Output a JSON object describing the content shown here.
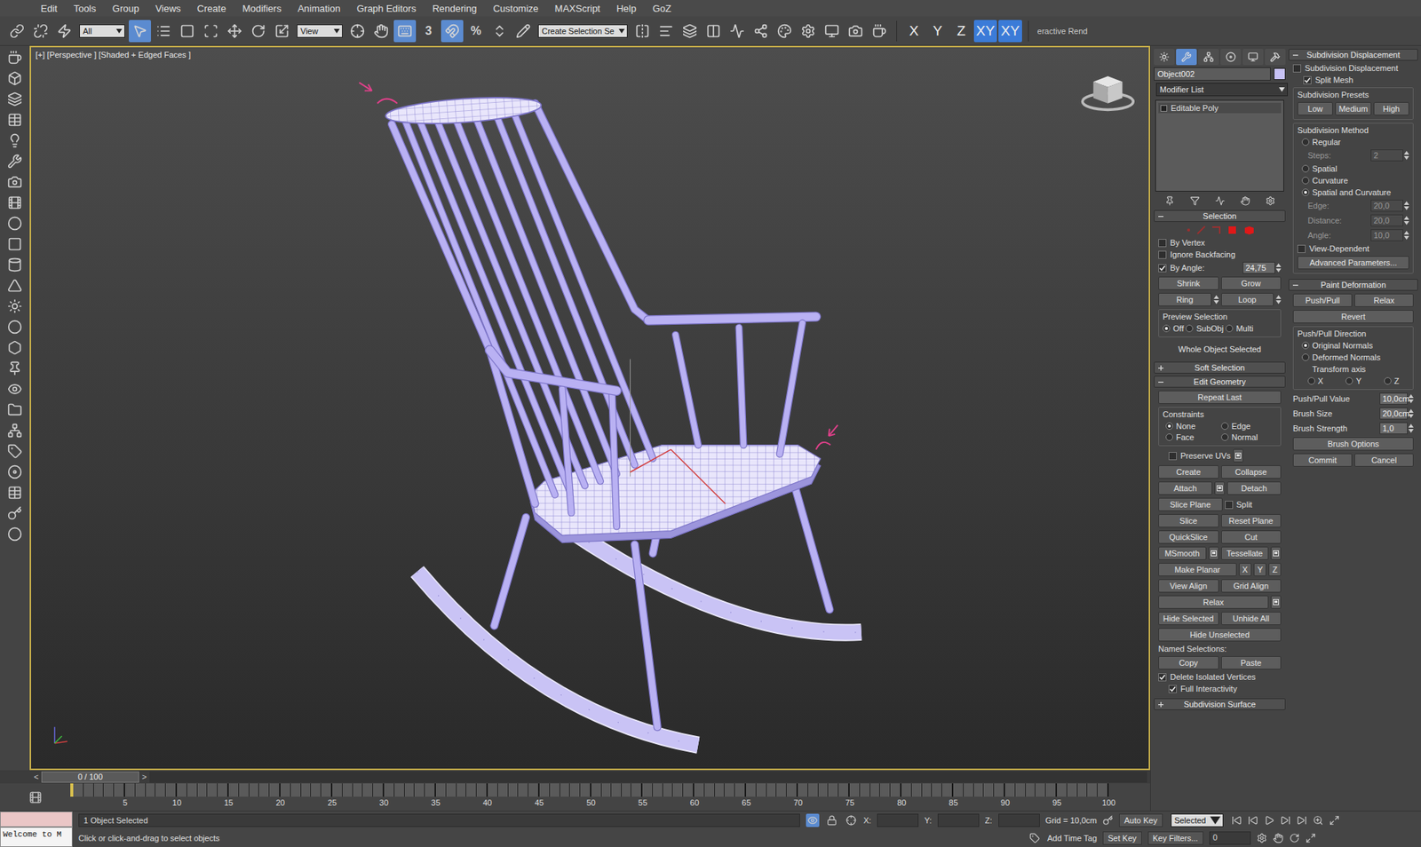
{
  "menu": [
    "Edit",
    "Tools",
    "Group",
    "Views",
    "Create",
    "Modifiers",
    "Animation",
    "Graph Editors",
    "Rendering",
    "Customize",
    "MAXScript",
    "Help",
    "GoZ"
  ],
  "toolbar": {
    "items": [
      {
        "kind": "icon",
        "icon": "link",
        "selected": false
      },
      {
        "kind": "icon",
        "icon": "unlink",
        "selected": false
      },
      {
        "kind": "icon",
        "icon": "bind",
        "selected": false
      },
      {
        "kind": "dropdown",
        "label": "All"
      },
      {
        "kind": "icon",
        "icon": "select",
        "selected": true
      },
      {
        "kind": "icon",
        "icon": "select-name",
        "selected": false
      },
      {
        "kind": "icon",
        "icon": "region",
        "selected": false
      },
      {
        "kind": "icon",
        "icon": "window",
        "selected": false
      },
      {
        "kind": "icon",
        "icon": "move",
        "selected": false
      },
      {
        "kind": "icon",
        "icon": "rotate",
        "selected": false
      },
      {
        "kind": "icon",
        "icon": "scale",
        "selected": false
      },
      {
        "kind": "dropdown",
        "label": "View"
      },
      {
        "kind": "icon",
        "icon": "pivot",
        "selected": false
      },
      {
        "kind": "icon",
        "icon": "manipulate",
        "selected": false
      },
      {
        "kind": "icon",
        "icon": "keyboard",
        "selected": true
      },
      {
        "kind": "snap",
        "label": "3",
        "selected": false
      },
      {
        "kind": "icon",
        "icon": "angle-snap",
        "selected": true
      },
      {
        "kind": "snap",
        "label": "%",
        "selected": false
      },
      {
        "kind": "icon",
        "icon": "spinner-snap",
        "selected": false
      },
      {
        "kind": "icon",
        "icon": "edit-named",
        "selected": false
      },
      {
        "kind": "dropdown",
        "label": "Create Selection Se"
      },
      {
        "kind": "icon",
        "icon": "mirror",
        "selected": false
      },
      {
        "kind": "icon",
        "icon": "align",
        "selected": false
      },
      {
        "kind": "icon",
        "icon": "layers",
        "selected": false
      },
      {
        "kind": "icon",
        "icon": "ribbon",
        "selected": false
      },
      {
        "kind": "icon",
        "icon": "curve",
        "selected": false
      },
      {
        "kind": "icon",
        "icon": "schematic",
        "selected": false
      },
      {
        "kind": "icon",
        "icon": "material",
        "selected": false
      },
      {
        "kind": "icon",
        "icon": "render-setup",
        "selected": false
      },
      {
        "kind": "icon",
        "icon": "rendered-frame",
        "selected": false
      },
      {
        "kind": "icon",
        "icon": "render",
        "selected": false
      },
      {
        "kind": "icon",
        "icon": "teapot",
        "selected": false
      },
      {
        "kind": "sep"
      },
      {
        "kind": "axis",
        "label": "X",
        "selected": false
      },
      {
        "kind": "axis",
        "label": "Y",
        "selected": false
      },
      {
        "kind": "axis",
        "label": "Z",
        "selected": false
      },
      {
        "kind": "axis",
        "label": "XY",
        "selected": true
      },
      {
        "kind": "axis",
        "label": "XY",
        "selected": true
      },
      {
        "kind": "sep"
      },
      {
        "kind": "text",
        "label": "eractive Rend"
      }
    ]
  },
  "viewport": {
    "label": "[+] [Perspective ] [Shaded + Edged Faces ]"
  },
  "command_panel": {
    "tabs": [
      {
        "kind": "create",
        "selected": false
      },
      {
        "kind": "modify",
        "selected": true
      },
      {
        "kind": "hierarchy",
        "selected": false
      },
      {
        "kind": "motion",
        "selected": false
      },
      {
        "kind": "display",
        "selected": false
      },
      {
        "kind": "utilities",
        "selected": false
      }
    ],
    "object_name": "Object002",
    "object_color": "#c8c2f6",
    "modifier_list": "Modifier List",
    "stack": [
      {
        "label": "Editable Poly",
        "selected": false
      }
    ],
    "selection": {
      "title": "Selection",
      "expanded": true,
      "checks": [
        {
          "label": "By Vertex",
          "checked": false
        },
        {
          "label": "Ignore Backfacing",
          "checked": false
        }
      ],
      "by_angle": {
        "label": "By Angle:",
        "checked": true,
        "value": "24,75"
      },
      "grow_buttons": [
        "Shrink",
        "Grow"
      ],
      "ring": "Ring",
      "loop": "Loop",
      "preview": {
        "title": "Preview Selection",
        "options": [
          {
            "label": "Off",
            "selected": true
          },
          {
            "label": "SubObj",
            "selected": false
          },
          {
            "label": "Multi",
            "selected": false
          }
        ]
      },
      "status": "Whole Object Selected"
    },
    "soft_selection": {
      "title": "Soft Selection",
      "expanded": false
    },
    "edit_geometry": {
      "title": "Edit Geometry",
      "expanded": true,
      "repeat_last": "Repeat Last",
      "constraints": {
        "title": "Constraints",
        "options": [
          {
            "label": "None",
            "selected": true
          },
          {
            "label": "Edge",
            "selected": false
          },
          {
            "label": "Face",
            "selected": false
          },
          {
            "label": "Normal",
            "selected": false
          }
        ]
      },
      "preserve_uvs": {
        "label": "Preserve UVs",
        "checked": false
      },
      "rows": [
        [
          {
            "kind": "button",
            "label": "Create"
          },
          {
            "kind": "button",
            "label": "Collapse"
          }
        ],
        [
          {
            "kind": "button-settings",
            "label": "Attach"
          },
          {
            "kind": "button",
            "label": "Detach"
          }
        ],
        [
          {
            "kind": "button",
            "label": "Slice Plane"
          },
          {
            "kind": "check",
            "label": "Split",
            "checked": false
          }
        ],
        [
          {
            "kind": "button",
            "label": "Slice"
          },
          {
            "kind": "button",
            "label": "Reset Plane"
          }
        ],
        [
          {
            "kind": "button",
            "label": "QuickSlice"
          },
          {
            "kind": "button",
            "label": "Cut"
          }
        ],
        [
          {
            "kind": "button-settings",
            "label": "MSmooth"
          },
          {
            "kind": "button-settings",
            "label": "Tessellate"
          }
        ],
        [
          {
            "kind": "button",
            "label": "Make Planar"
          },
          {
            "kind": "small",
            "label": "X"
          },
          {
            "kind": "small",
            "label": "Y"
          },
          {
            "kind": "small",
            "label": "Z"
          }
        ],
        [
          {
            "kind": "button",
            "label": "View Align"
          },
          {
            "kind": "button",
            "label": "Grid Align"
          }
        ],
        [
          {
            "kind": "button-settings",
            "label": "Relax"
          }
        ],
        [
          {
            "kind": "button",
            "label": "Hide Selected"
          },
          {
            "kind": "button",
            "label": "Unhide All"
          }
        ],
        [
          {
            "kind": "button",
            "label": "Hide Unselected"
          }
        ]
      ],
      "named_selections": {
        "label": "Named Selections:",
        "buttons": [
          "Copy",
          "Paste"
        ]
      },
      "checks": [
        {
          "label": "Delete Isolated Vertices",
          "checked": true
        },
        {
          "label": "Full Interactivity",
          "checked": true
        }
      ]
    },
    "subdivision_surface": {
      "title": "Subdivision Surface",
      "expanded": false
    },
    "subdivision_displacement": {
      "title": "Subdivision Displacement",
      "expanded": true,
      "checks": [
        {
          "label": "Subdivision Displacement",
          "checked": false
        },
        {
          "label": "Split Mesh",
          "checked": true
        }
      ],
      "presets": {
        "title": "Subdivision Presets",
        "buttons": [
          "Low",
          "Medium",
          "High"
        ]
      },
      "method": {
        "title": "Subdivision Method",
        "options": [
          {
            "label": "Regular",
            "selected": false
          },
          {
            "label": "Spatial",
            "selected": false
          },
          {
            "label": "Curvature",
            "selected": false
          },
          {
            "label": "Spatial and Curvature",
            "selected": true
          }
        ],
        "steps": {
          "label": "Steps:",
          "value": "2",
          "disabled": true
        },
        "fields": [
          {
            "label": "Edge:",
            "value": "20,0"
          },
          {
            "label": "Distance:",
            "value": "20,0"
          },
          {
            "label": "Angle:",
            "value": "10,0"
          }
        ]
      },
      "view_dependent": {
        "label": "View-Dependent",
        "checked": false
      },
      "advanced": "Advanced Parameters..."
    },
    "paint_deformation": {
      "title": "Paint Deformation",
      "expanded": true,
      "buttons": [
        "Push/Pull",
        "Relax"
      ],
      "revert": "Revert",
      "direction": {
        "title": "Push/Pull Direction",
        "options": [
          {
            "label": "Original Normals",
            "selected": true
          },
          {
            "label": "Deformed Normals",
            "selected": false
          }
        ],
        "axis_label": "Transform axis",
        "axes": [
          {
            "label": "X",
            "selected": false
          },
          {
            "label": "Y",
            "selected": false
          },
          {
            "label": "Z",
            "selected": false
          }
        ]
      },
      "fields": [
        {
          "label": "Push/Pull Value",
          "value": "10,0cm"
        },
        {
          "label": "Brush Size",
          "value": "20,0cm"
        },
        {
          "label": "Brush Strength",
          "value": "1,0"
        }
      ],
      "brush_options": "Brush Options",
      "actions": [
        "Commit",
        "Cancel"
      ]
    }
  },
  "timeline": {
    "prev": "<",
    "frame": "0 / 100",
    "next": ">",
    "ticks": [
      "5",
      "10",
      "15",
      "20",
      "25",
      "30",
      "35",
      "40",
      "45",
      "50",
      "55",
      "60",
      "65",
      "70",
      "75",
      "80",
      "85",
      "90",
      "95",
      "100"
    ]
  },
  "status": {
    "listener": "Welcome to M",
    "selection": "1 Object Selected",
    "prompt": "Click or click-and-drag to select objects",
    "coords": [
      "X:",
      "Y:",
      "Z:"
    ],
    "grid": "Grid = 10,0cm",
    "time_tag": "Add Time Tag",
    "auto_key": "Auto Key",
    "key_mode": "Selected",
    "set_key": "Set Key",
    "key_filters": "Key Filters...",
    "frame": "0"
  }
}
